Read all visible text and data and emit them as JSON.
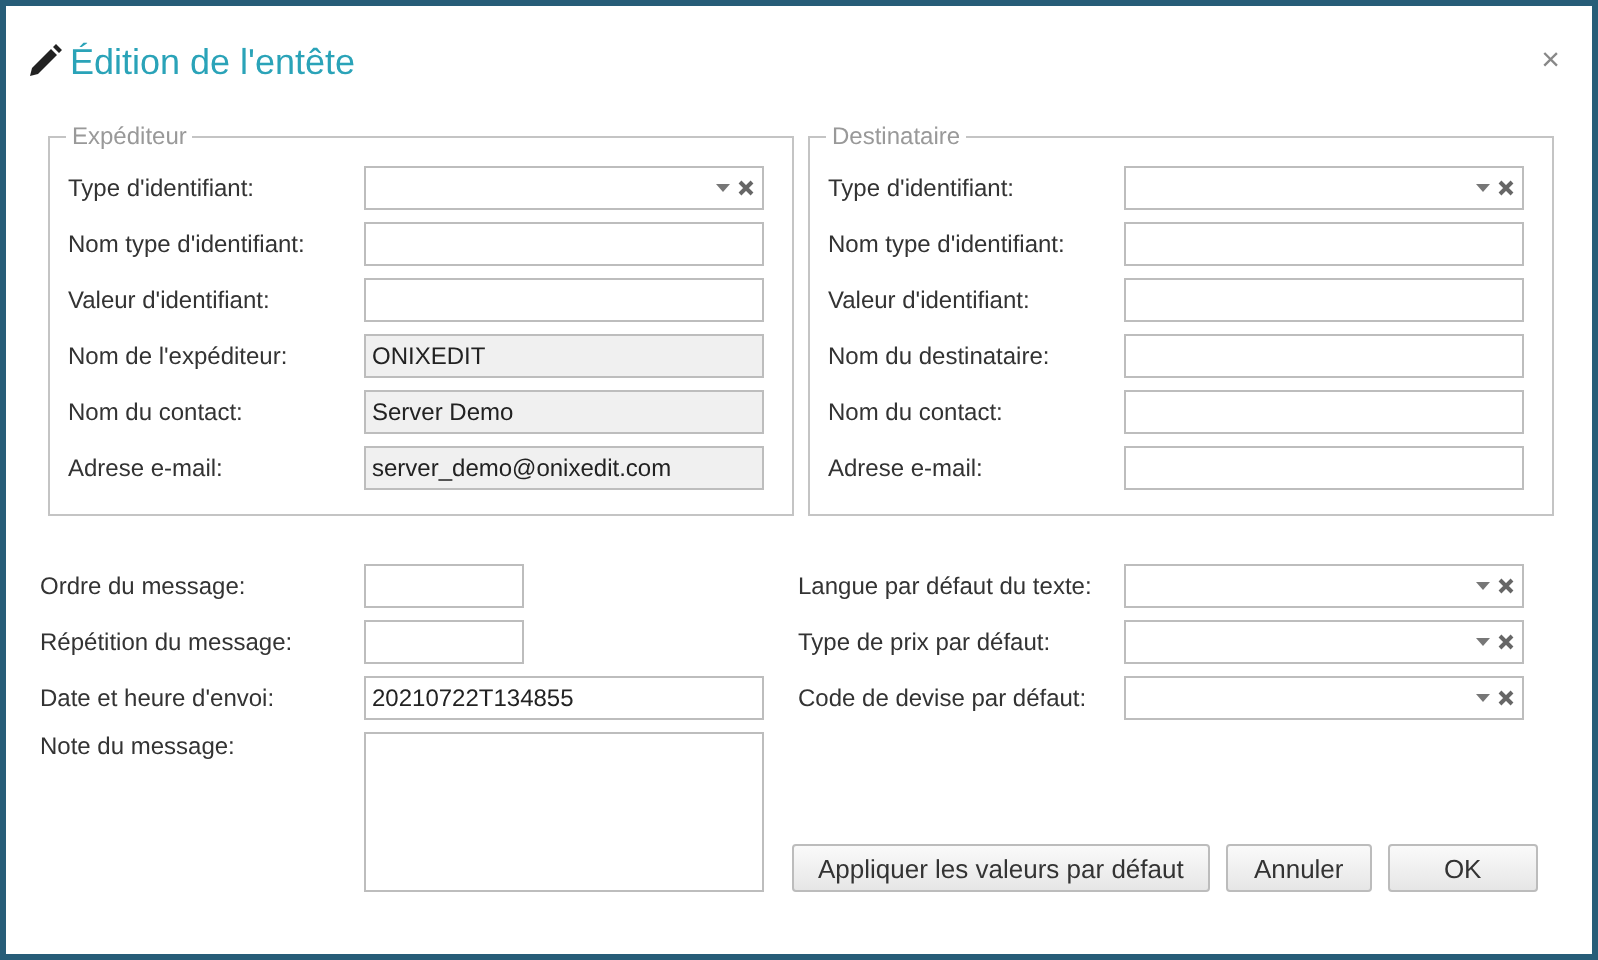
{
  "dialog": {
    "title": "Édition de l'entête",
    "close": "×"
  },
  "groups": [
    {
      "legend": "Expéditeur",
      "fields": [
        {
          "label": "Type d'identifiant:",
          "kind": "select",
          "disabled": false
        },
        {
          "label": "Nom type d'identifiant:",
          "kind": "text",
          "disabled": false
        },
        {
          "label": "Valeur d'identifiant:",
          "kind": "text",
          "disabled": false
        },
        {
          "label": "Nom de l'expéditeur:",
          "kind": "text",
          "value": "ONIXEDIT",
          "disabled": true
        },
        {
          "label": "Nom du contact:",
          "kind": "text",
          "value": "Server Demo",
          "disabled": true
        },
        {
          "label": "Adrese e-mail:",
          "kind": "text",
          "value": "server_demo@onixedit.com",
          "disabled": true
        }
      ]
    },
    {
      "legend": "Destinataire",
      "fields": [
        {
          "label": "Type d'identifiant:",
          "kind": "select",
          "disabled": false
        },
        {
          "label": "Nom type d'identifiant:",
          "kind": "text",
          "disabled": false
        },
        {
          "label": "Valeur d'identifiant:",
          "kind": "text",
          "disabled": false
        },
        {
          "label": "Nom du destinataire:",
          "kind": "text",
          "disabled": false
        },
        {
          "label": "Nom du contact:",
          "kind": "text",
          "disabled": false
        },
        {
          "label": "Adrese e-mail:",
          "kind": "text",
          "disabled": false
        }
      ]
    }
  ],
  "message_fields": [
    {
      "label": "Ordre du message:",
      "kind": "short",
      "disabled": false
    },
    {
      "label": "Répétition du message:",
      "kind": "short",
      "disabled": false
    },
    {
      "label": "Date et heure d'envoi:",
      "kind": "text",
      "value": "20210722T134855",
      "disabled": false
    },
    {
      "label": "Note du message:",
      "kind": "textarea",
      "disabled": false
    }
  ],
  "default_fields": [
    {
      "label": "Langue par défaut du texte:",
      "kind": "select",
      "disabled": false
    },
    {
      "label": "Type de prix par défaut:",
      "kind": "select",
      "disabled": false
    },
    {
      "label": "Code de devise par défaut:",
      "kind": "select",
      "disabled": false
    }
  ],
  "buttons": [
    "Appliquer les valeurs par défaut",
    "Annuler",
    "OK"
  ]
}
